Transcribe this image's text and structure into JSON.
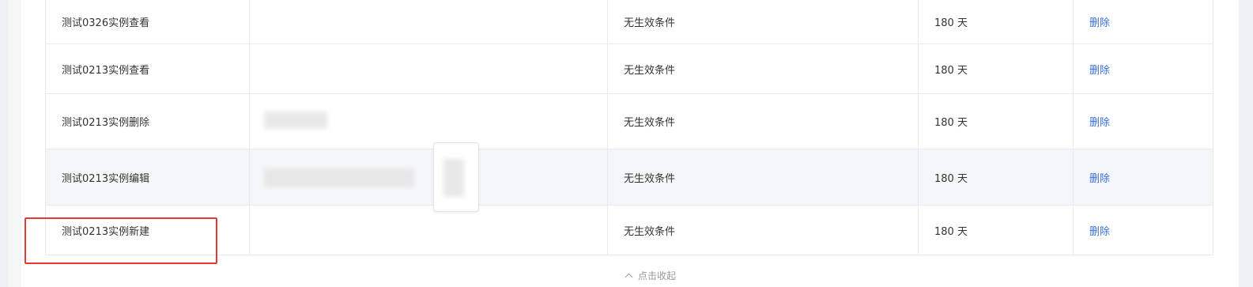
{
  "rows": [
    {
      "name": "测试0326实例查看",
      "condition": "无生效条件",
      "duration": "180 天",
      "action": "删除"
    },
    {
      "name": "测试0213实例查看",
      "condition": "无生效条件",
      "duration": "180 天",
      "action": "删除"
    },
    {
      "name": "测试0213实例删除",
      "condition": "无生效条件",
      "duration": "180 天",
      "action": "删除"
    },
    {
      "name": "测试0213实例编辑",
      "condition": "无生效条件",
      "duration": "180 天",
      "action": "删除"
    },
    {
      "name": "测试0213实例新建",
      "condition": "无生效条件",
      "duration": "180 天",
      "action": "删除"
    }
  ],
  "footer": {
    "collapse_label": "点击收起"
  },
  "colors": {
    "link": "#3b6fe0",
    "highlight_border": "#e53935",
    "row_highlight": "#f5f6fa"
  }
}
